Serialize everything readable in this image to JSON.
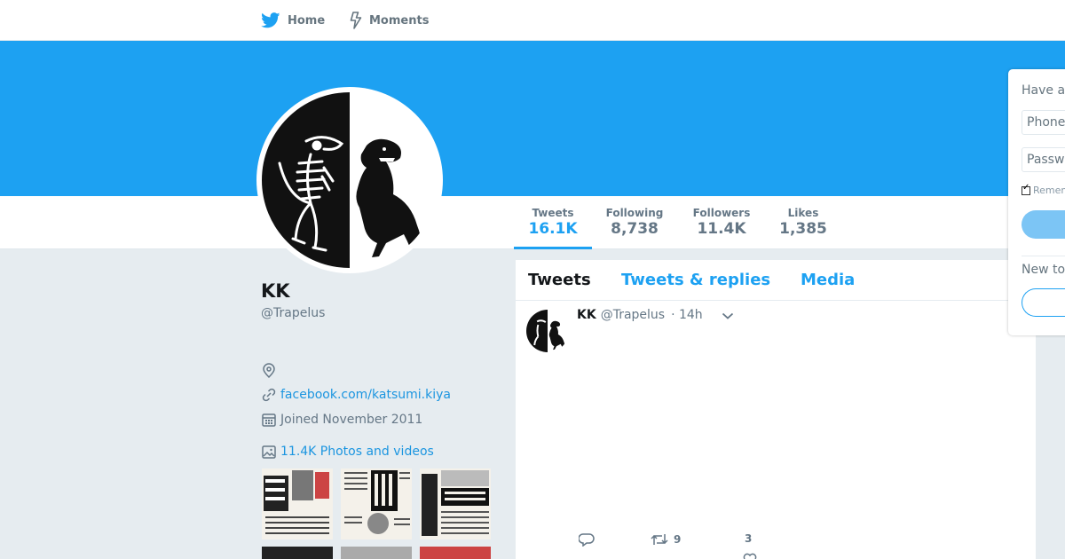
{
  "nav": {
    "home_label": "Home",
    "home_icon": "twitter-bird-icon",
    "moments_label": "Moments",
    "moments_icon": "lightning-icon"
  },
  "colors": {
    "brand": "#1da1f2",
    "link": "#1b95e0",
    "muted": "#657786",
    "background": "#e6ecf0"
  },
  "stats": [
    {
      "label": "Tweets",
      "value": "16.1K",
      "active": true
    },
    {
      "label": "Following",
      "value": "8,738",
      "active": false
    },
    {
      "label": "Followers",
      "value": "11.4K",
      "active": false
    },
    {
      "label": "Likes",
      "value": "1,385",
      "active": false
    }
  ],
  "profile": {
    "name": "KK",
    "handle": "@Trapelus",
    "website": "facebook.com/katsumi.kiya",
    "joined": "Joined November 2011",
    "media_label": "11.4K Photos and videos"
  },
  "timeline": {
    "tabs": [
      {
        "label": "Tweets",
        "active": true
      },
      {
        "label": "Tweets & replies",
        "active": false
      },
      {
        "label": "Media",
        "active": false
      }
    ]
  },
  "tweet": {
    "name": "KK",
    "handle": "@Trapelus",
    "time": "· 14h",
    "retweets": "9",
    "likes": "3"
  },
  "login": {
    "title": "Have a",
    "phone_placeholder": "Phone",
    "password_placeholder": "Passw",
    "remember_label": "Remem",
    "new_label": "New to"
  }
}
